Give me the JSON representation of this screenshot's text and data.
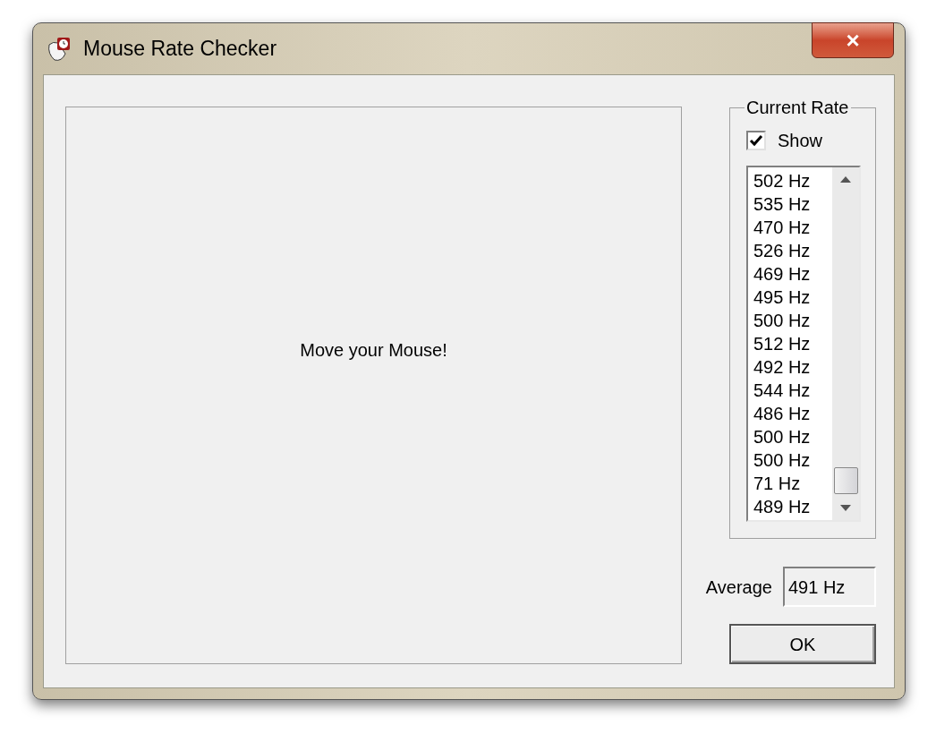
{
  "window": {
    "title": "Mouse Rate Checker",
    "close_label": "×"
  },
  "canvas": {
    "message": "Move your Mouse!"
  },
  "current_rate": {
    "title": "Current Rate",
    "show": {
      "label": "Show",
      "checked": true
    },
    "items": [
      "502 Hz",
      "535 Hz",
      "470 Hz",
      "526 Hz",
      "469 Hz",
      "495 Hz",
      "500 Hz",
      "512 Hz",
      "492 Hz",
      "544 Hz",
      "486 Hz",
      "500 Hz",
      "500 Hz",
      "71 Hz",
      "489 Hz"
    ]
  },
  "average": {
    "label": "Average",
    "value": "491 Hz"
  },
  "buttons": [
    "OK"
  ]
}
